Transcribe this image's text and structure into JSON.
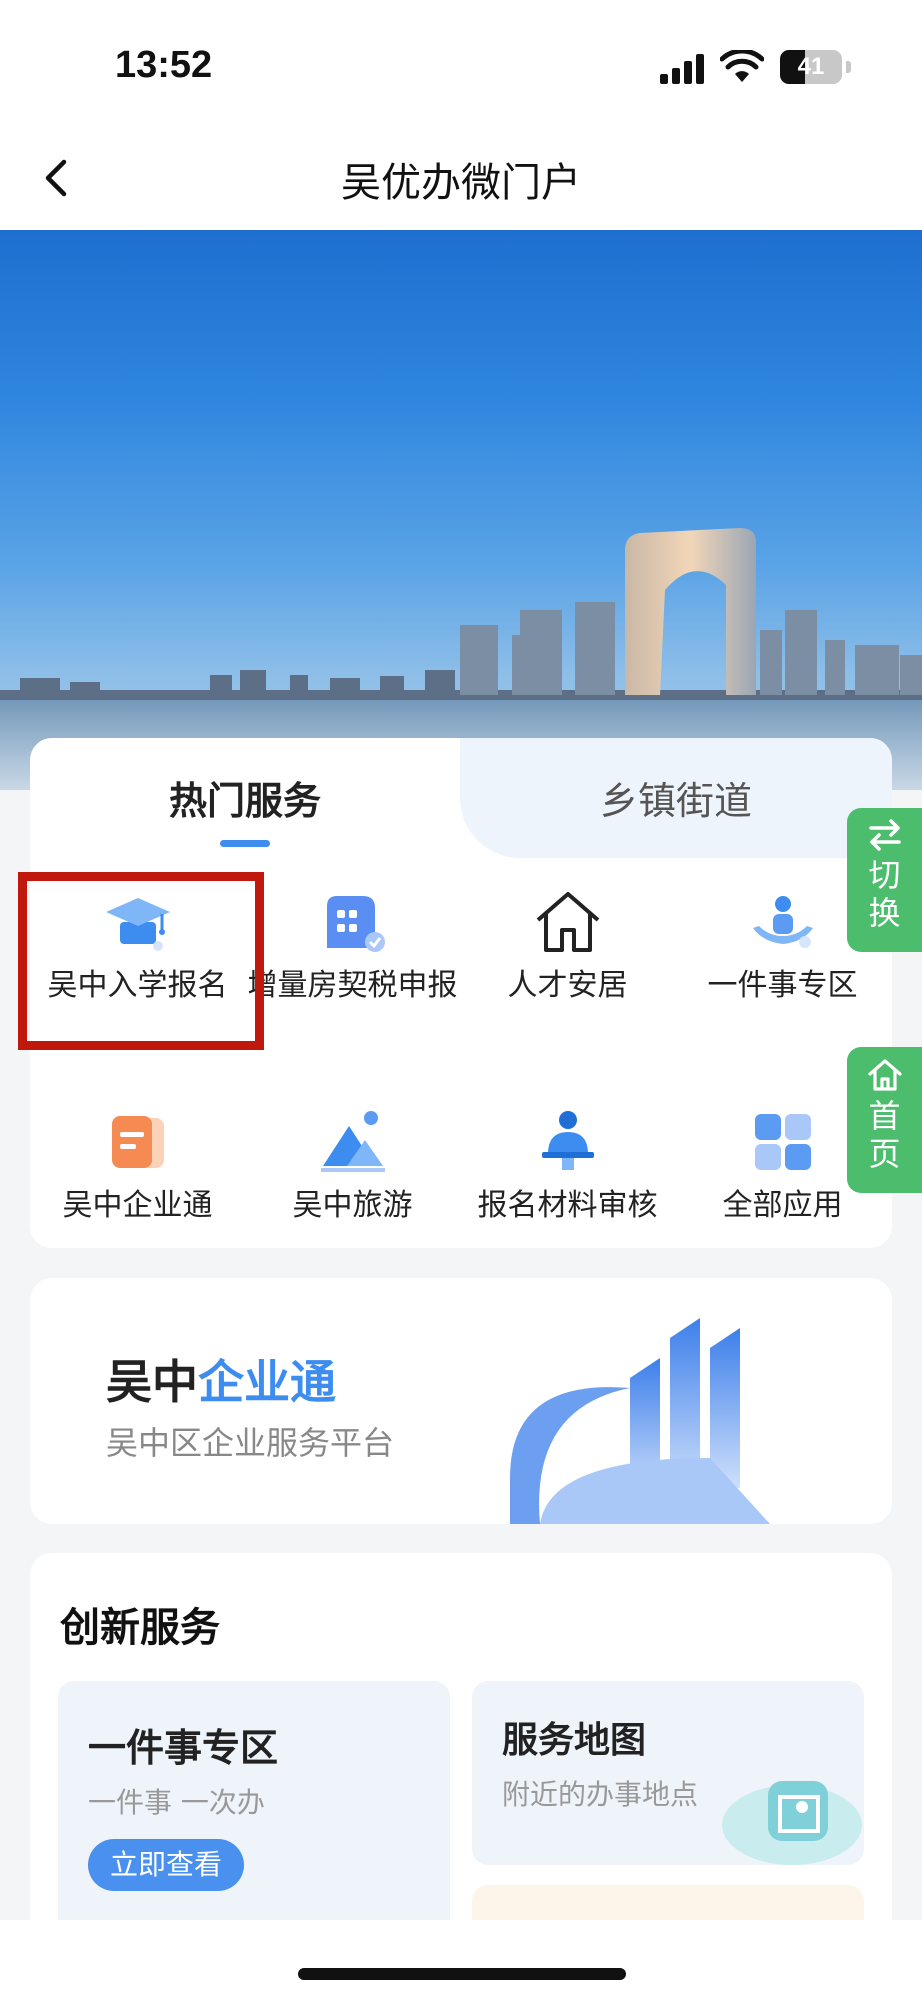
{
  "status_bar": {
    "time": "13:52",
    "battery": "41",
    "battery_level": 0.41
  },
  "nav": {
    "title": "吴优办微门户",
    "back_icon": "chevron-left-icon"
  },
  "banner": {
    "description": ""
  },
  "services": {
    "tabs": [
      {
        "label": "热门服务",
        "active": true
      },
      {
        "label": "乡镇街道",
        "active": false
      }
    ],
    "items": [
      {
        "label": "吴中入学报名",
        "icon": "graduation-cap-icon"
      },
      {
        "label": "增量房契税申报",
        "icon": "building-check-icon"
      },
      {
        "label": "人才安居",
        "icon": "house-icon"
      },
      {
        "label": "一件事专区",
        "icon": "hand-person-icon"
      },
      {
        "label": "吴中企业通",
        "icon": "document-icon"
      },
      {
        "label": "吴中旅游",
        "icon": "mountain-icon"
      },
      {
        "label": "报名材料审核",
        "icon": "worker-desk-icon"
      },
      {
        "label": "全部应用",
        "icon": "grid-icon"
      }
    ]
  },
  "floating": {
    "switch_label_1": "切",
    "switch_label_2": "换",
    "home_label_1": "首",
    "home_label_2": "页"
  },
  "enterprise": {
    "title_a": "吴中",
    "title_b": "企业通",
    "subtitle": "吴中区企业服务平台"
  },
  "innovation": {
    "heading": "创新服务",
    "one_thing": {
      "title": "一件事专区",
      "subtitle": "一件事 一次办",
      "button": "立即查看"
    },
    "service_map": {
      "title": "服务地图",
      "subtitle": "附近的办事地点"
    }
  },
  "colors": {
    "accent": "#3d8cf0",
    "green": "#4cbd6d",
    "highlight": "#c0180c"
  }
}
